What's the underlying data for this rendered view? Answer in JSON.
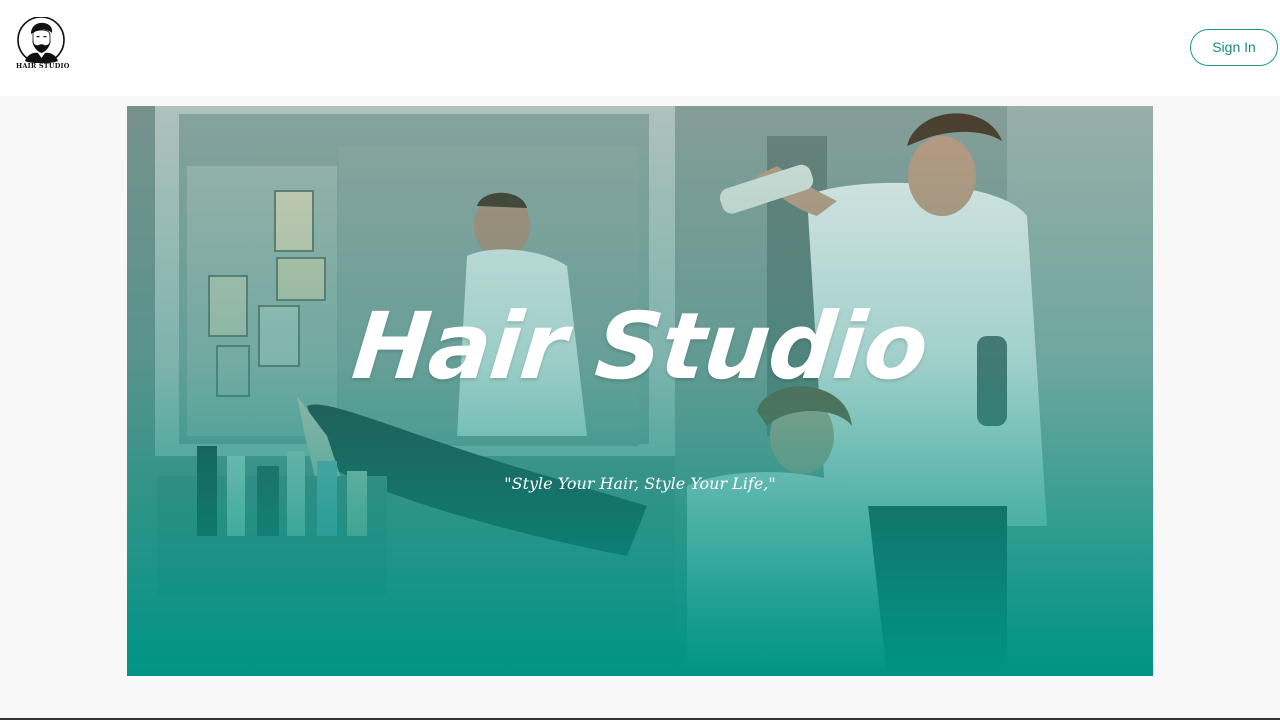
{
  "header": {
    "logo_text": "HAIR STUDIO",
    "signin_label": "Sign In"
  },
  "hero": {
    "title": "Hair Studio",
    "tagline": "\"Style Your Hair, Style Your Life,\""
  },
  "colors": {
    "accent": "#1a9b8e",
    "hero_bottom": "#009485",
    "header_bg": "#ffffff",
    "page_bg": "#f8f8f8"
  },
  "icons": {
    "logo": "bearded-man-logo-icon"
  }
}
